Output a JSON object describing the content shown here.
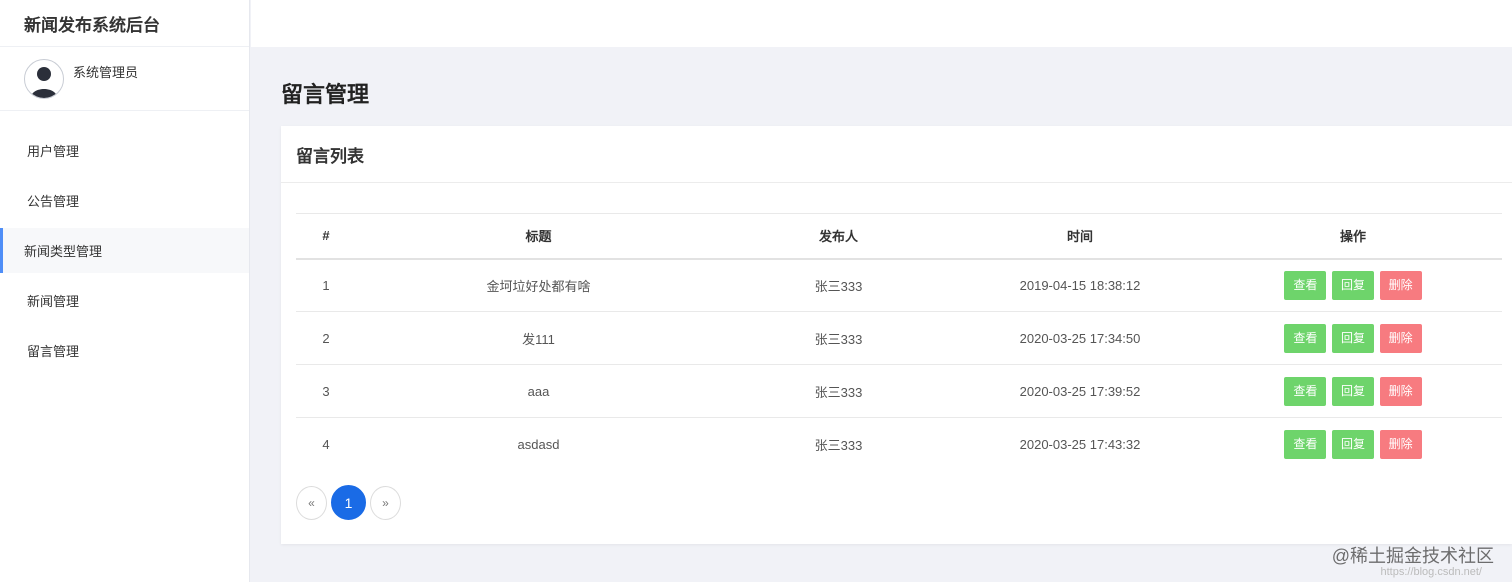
{
  "app": {
    "brand": "新闻发布系统后台"
  },
  "user": {
    "name": "系统管理员"
  },
  "sidebar": {
    "items": [
      {
        "label": "用户管理"
      },
      {
        "label": "公告管理"
      },
      {
        "label": "新闻类型管理"
      },
      {
        "label": "新闻管理"
      },
      {
        "label": "留言管理"
      }
    ]
  },
  "page": {
    "title": "留言管理"
  },
  "card": {
    "title": "留言列表"
  },
  "table": {
    "headers": [
      "#",
      "标题",
      "发布人",
      "时间",
      "操作"
    ],
    "rows": [
      {
        "idx": "1",
        "title": "金坷垃好处都有啥",
        "author": "张三333",
        "time": "2019-04-15 18:38:12"
      },
      {
        "idx": "2",
        "title": "发111",
        "author": "张三333",
        "time": "2020-03-25 17:34:50"
      },
      {
        "idx": "3",
        "title": "aaa",
        "author": "张三333",
        "time": "2020-03-25 17:39:52"
      },
      {
        "idx": "4",
        "title": "asdasd",
        "author": "张三333",
        "time": "2020-03-25 17:43:32"
      }
    ],
    "actions": {
      "view": "查看",
      "reply": "回复",
      "delete": "删除"
    }
  },
  "pagination": {
    "prev": "«",
    "current": "1",
    "next": "»"
  },
  "watermark": {
    "text": "@稀土掘金技术社区",
    "sub": "https://blog.csdn.net/"
  },
  "colors": {
    "accent": "#4f8ef7",
    "success": "#6ed46b",
    "danger": "#f77b80",
    "primary": "#1a6be6"
  }
}
